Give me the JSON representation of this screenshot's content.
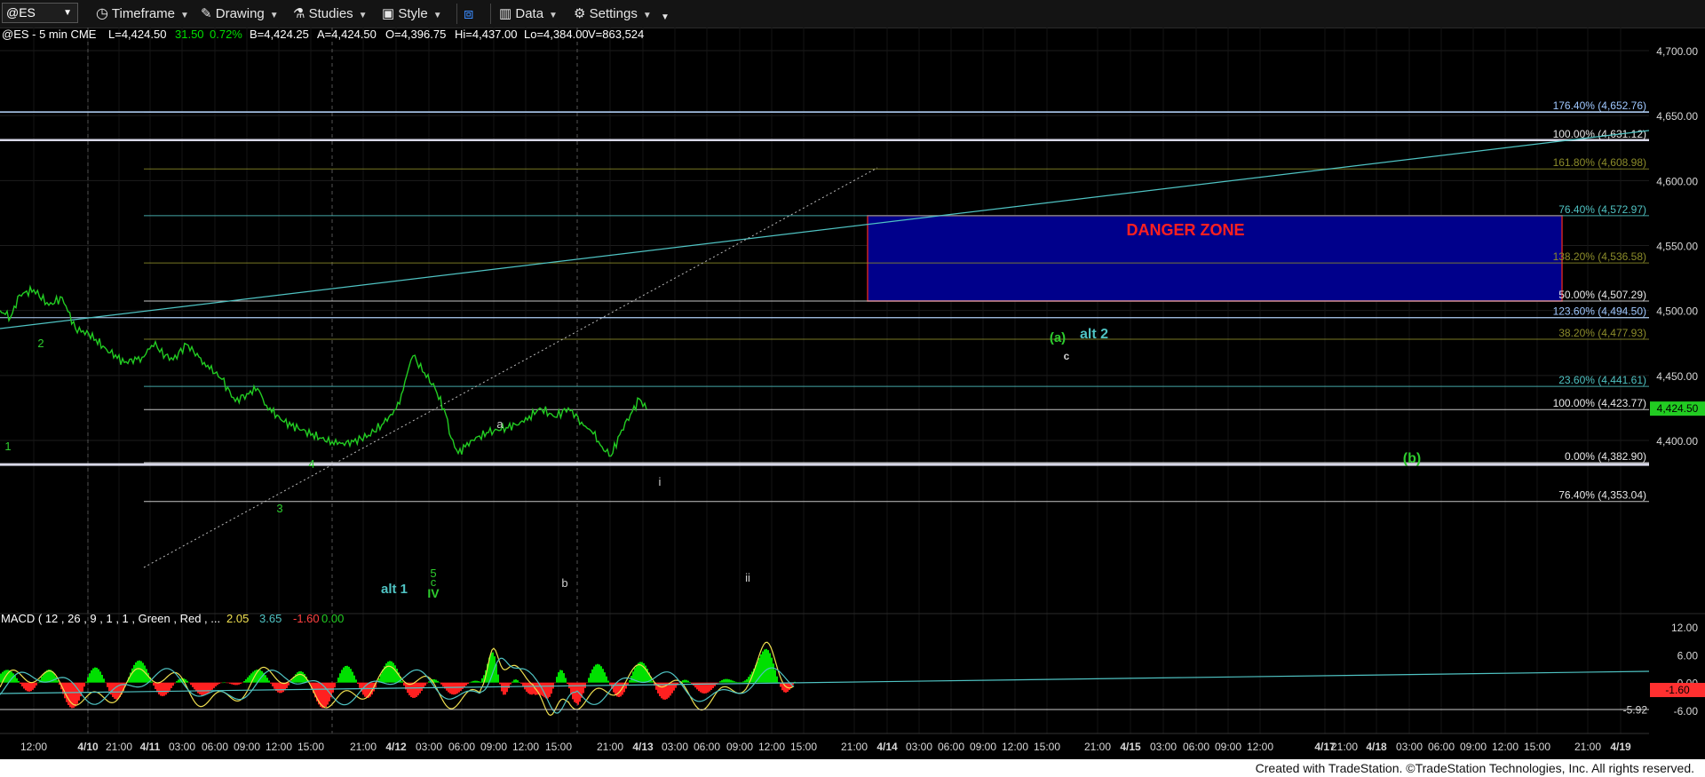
{
  "toolbar": {
    "symbol": "@ES",
    "timeframe": "Timeframe",
    "drawing": "Drawing",
    "studies": "Studies",
    "style": "Style",
    "data": "Data",
    "settings": "Settings"
  },
  "header": {
    "symbol_info": "@ES - 5 min  CME",
    "last": "L=4,424.50",
    "change": "31.50",
    "change_pct": "0.72%",
    "bid": "B=4,424.25",
    "ask": "A=4,424.50",
    "open": "O=4,396.75",
    "high": "Hi=4,437.00",
    "low": "Lo=4,384.00",
    "volume": "V=863,524"
  },
  "colors": {
    "up": "#00e000",
    "down": "#ff3030",
    "teal": "#4fc3c3",
    "price_line": "#22cc22",
    "danger_fill": "#00008b",
    "danger_text": "#ff2020",
    "olive": "#8c8c2a"
  },
  "chart_data": {
    "type": "line",
    "title": "@ES - 5 min",
    "ylim": [
      4340,
      4715
    ],
    "y_ticks": [
      "4,700.00",
      "4,650.00",
      "4,600.00",
      "4,550.00",
      "4,500.00",
      "4,450.00",
      "4,400.00"
    ],
    "last_price_tag": "4,424.50",
    "x_ticks": [
      "12:00",
      "4/10",
      "21:00",
      "4/11",
      "03:00",
      "06:00",
      "09:00",
      "12:00",
      "15:00",
      "21:00",
      "4/12",
      "03:00",
      "06:00",
      "09:00",
      "12:00",
      "15:00",
      "21:00",
      "4/13",
      "03:00",
      "06:00",
      "09:00",
      "12:00",
      "15:00",
      "21:00",
      "4/14",
      "03:00",
      "06:00",
      "09:00",
      "12:00",
      "15:00",
      "21:00",
      "4/15",
      "03:00",
      "06:00",
      "09:00",
      "12:00",
      "4/17",
      "21:00",
      "4/18",
      "03:00",
      "06:00",
      "09:00",
      "12:00",
      "15:00",
      "21:00",
      "4/19"
    ],
    "price_path": [
      [
        0,
        4500
      ],
      [
        12,
        4495
      ],
      [
        22,
        4512
      ],
      [
        38,
        4516
      ],
      [
        55,
        4504
      ],
      [
        70,
        4510
      ],
      [
        85,
        4486
      ],
      [
        100,
        4482
      ],
      [
        120,
        4470
      ],
      [
        140,
        4460
      ],
      [
        160,
        4464
      ],
      [
        175,
        4476
      ],
      [
        180,
        4468
      ],
      [
        195,
        4462
      ],
      [
        210,
        4474
      ],
      [
        230,
        4460
      ],
      [
        250,
        4447
      ],
      [
        265,
        4430
      ],
      [
        278,
        4436
      ],
      [
        290,
        4440
      ],
      [
        300,
        4427
      ],
      [
        318,
        4415
      ],
      [
        340,
        4408
      ],
      [
        360,
        4402
      ],
      [
        380,
        4397
      ],
      [
        398,
        4399
      ],
      [
        415,
        4404
      ],
      [
        430,
        4412
      ],
      [
        440,
        4420
      ],
      [
        450,
        4428
      ],
      [
        458,
        4450
      ],
      [
        465,
        4465
      ],
      [
        478,
        4452
      ],
      [
        490,
        4440
      ],
      [
        502,
        4420
      ],
      [
        508,
        4402
      ],
      [
        516,
        4390
      ],
      [
        530,
        4400
      ],
      [
        550,
        4406
      ],
      [
        570,
        4410
      ],
      [
        590,
        4414
      ],
      [
        608,
        4425
      ],
      [
        625,
        4418
      ],
      [
        640,
        4425
      ],
      [
        655,
        4414
      ],
      [
        668,
        4405
      ],
      [
        678,
        4395
      ],
      [
        688,
        4388
      ],
      [
        700,
        4408
      ],
      [
        710,
        4420
      ],
      [
        720,
        4432
      ],
      [
        728,
        4424
      ]
    ],
    "fib_lines": [
      {
        "label": "176.40% (4,652.76)",
        "value": 4652.76,
        "color": "#9fc8ff"
      },
      {
        "label": "100.00% (4,631.12)",
        "value": 4631.12,
        "color": "#e8e8e8"
      },
      {
        "label": "161.80% (4,608.98)",
        "value": 4608.98,
        "color": "#8c8c2a"
      },
      {
        "label": "76.40% (4,572.97)",
        "value": 4572.97,
        "color": "#4fc3c3"
      },
      {
        "label": "138.20% (4,536.58)",
        "value": 4536.58,
        "color": "#8c8c2a"
      },
      {
        "label": "50.00% (4,507.29)",
        "value": 4507.29,
        "color": "#e8e8e8"
      },
      {
        "label": "123.60% (4,494.50)",
        "value": 4494.5,
        "color": "#9fc8ff"
      },
      {
        "label": "38.20% (4,477.93)",
        "value": 4477.93,
        "color": "#8c8c2a"
      },
      {
        "label": "23.60% (4,441.61)",
        "value": 4441.61,
        "color": "#4fc3c3"
      },
      {
        "label": "100.00% (4,423.77)",
        "value": 4423.77,
        "color": "#e8e8e8"
      },
      {
        "label": "0.00% (4,382.90)",
        "value": 4382.9,
        "color": "#e8e8e8"
      },
      {
        "label": "76.40% (4,353.04)",
        "value": 4353.04,
        "color": "#e8e8e8"
      }
    ],
    "wave_labels": [
      {
        "text": "1",
        "color": "#2ecc2e"
      },
      {
        "text": "2",
        "color": "#2ecc2e"
      },
      {
        "text": "3",
        "color": "#2ecc2e"
      },
      {
        "text": "4",
        "color": "#2ecc2e"
      },
      {
        "text": "5",
        "color": "#2ecc2e"
      },
      {
        "text": "c",
        "color": "#2ecc2e"
      },
      {
        "text": "IV",
        "color": "#2ecc2e"
      },
      {
        "text": "alt 1",
        "color": "#4fc3c3"
      },
      {
        "text": "a",
        "color": "#cfcfcf"
      },
      {
        "text": "b",
        "color": "#cfcfcf"
      },
      {
        "text": "i",
        "color": "#cfcfcf"
      },
      {
        "text": "ii",
        "color": "#cfcfcf"
      },
      {
        "text": "(a)",
        "color": "#2ecc2e"
      },
      {
        "text": "alt 2",
        "color": "#4fc3c3"
      },
      {
        "text": "c",
        "color": "#cfcfcf"
      },
      {
        "text": "(b)",
        "color": "#2ecc2e"
      }
    ],
    "danger_zone": {
      "label": "DANGER ZONE",
      "top": 4572.97,
      "bottom": 4507.29
    }
  },
  "macd": {
    "label": "MACD ( 12 , 26 , 9 , 1 , 1 , Green , Red , ...",
    "macd": "2.05",
    "signal": "3.65",
    "diff": "-1.60",
    "zero": "0.00",
    "ylim": [
      -8.5,
      14
    ],
    "y_ticks": [
      "12.00",
      "6.00",
      "0.00",
      "-6.00"
    ],
    "tags": [
      "-1.60",
      "-5.92"
    ]
  },
  "footer": "Created with TradeStation. ©TradeStation Technologies, Inc. All rights reserved."
}
